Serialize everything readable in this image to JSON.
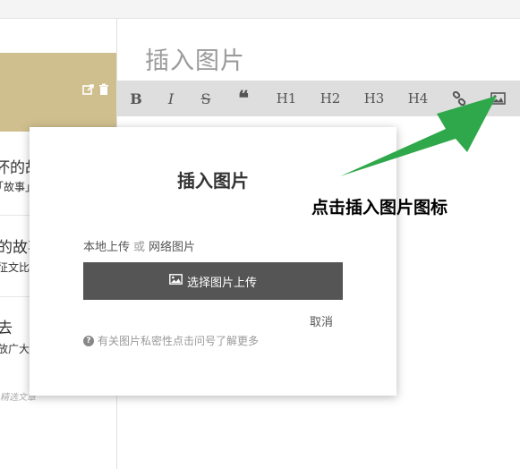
{
  "article_list": {
    "items": [
      {
        "title": "坏的故事",
        "subtitle": "「故事」征文"
      },
      {
        "title": "的故事",
        "subtitle": "征文比赛"
      },
      {
        "title": "去",
        "subtitle": "放广大书"
      }
    ],
    "meta": "精选文章"
  },
  "editor": {
    "title_placeholder": "插入图片",
    "toolbar": [
      {
        "label": "B",
        "name": "bold-button"
      },
      {
        "label": "I",
        "name": "italic-button"
      },
      {
        "label": "S",
        "name": "strikethrough-button"
      },
      {
        "label": "❝",
        "name": "quote-button"
      },
      {
        "label": "H1",
        "name": "h1-button"
      },
      {
        "label": "H2",
        "name": "h2-button"
      },
      {
        "label": "H3",
        "name": "h3-button"
      },
      {
        "label": "H4",
        "name": "h4-button"
      }
    ]
  },
  "modal": {
    "title": "插入图片",
    "local_upload": "本地上传",
    "or": "或",
    "web_image": "网络图片",
    "upload_button": "选择图片上传",
    "cancel": "取消",
    "privacy_note": "有关图片私密性点击问号了解更多"
  },
  "annotation": {
    "text": "点击插入图片图标",
    "color": "#2ea84a"
  }
}
